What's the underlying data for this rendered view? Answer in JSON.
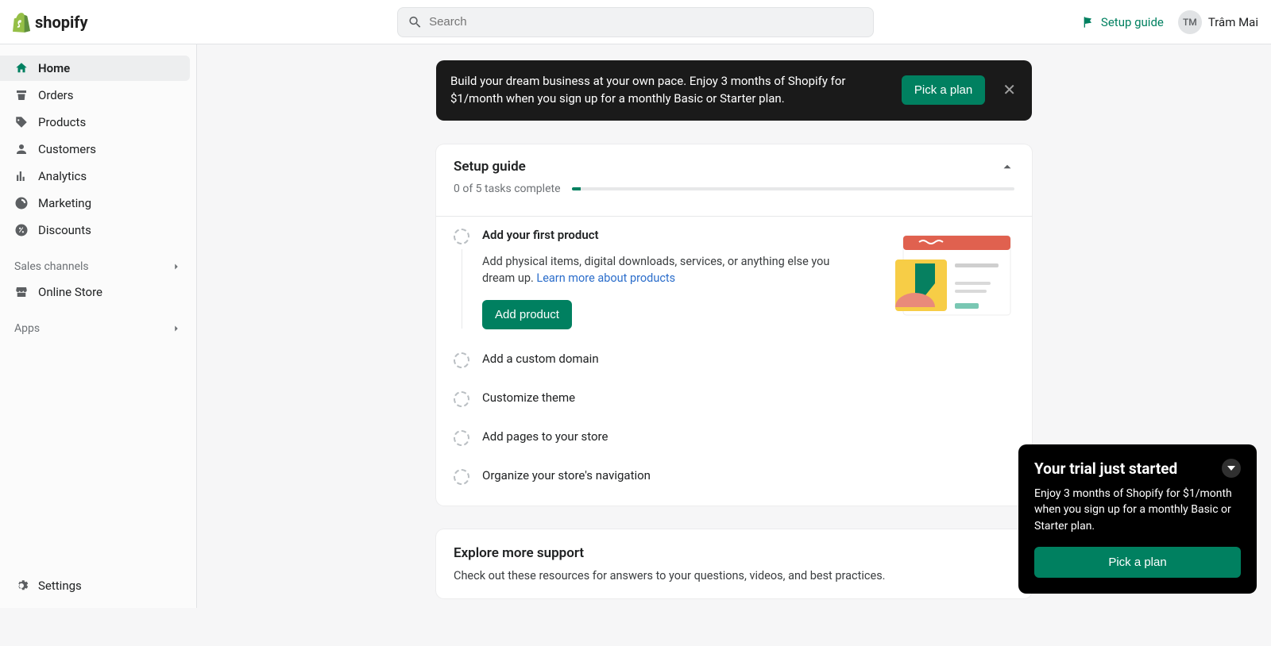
{
  "brand": "shopify",
  "search": {
    "placeholder": "Search"
  },
  "topbar": {
    "setup_link": "Setup guide",
    "user_initials": "TM",
    "user_name": "Trâm Mai"
  },
  "sidebar": {
    "items": [
      {
        "label": "Home"
      },
      {
        "label": "Orders"
      },
      {
        "label": "Products"
      },
      {
        "label": "Customers"
      },
      {
        "label": "Analytics"
      },
      {
        "label": "Marketing"
      },
      {
        "label": "Discounts"
      }
    ],
    "sales_channels_label": "Sales channels",
    "online_store_label": "Online Store",
    "apps_label": "Apps",
    "settings_label": "Settings"
  },
  "banner": {
    "text": "Build your dream business at your own pace. Enjoy 3 months of Shopify for $1/month when you sign up for a monthly Basic or Starter plan.",
    "cta": "Pick a plan"
  },
  "guide": {
    "title": "Setup guide",
    "progress_text": "0 of 5 tasks complete",
    "tasks": {
      "first": {
        "title": "Add your first product",
        "desc_a": "Add physical items, digital downloads, services, or anything else you dream up. ",
        "link": "Learn more about products",
        "cta": "Add product"
      },
      "list": [
        {
          "title": "Add a custom domain"
        },
        {
          "title": "Customize theme"
        },
        {
          "title": "Add pages to your store"
        },
        {
          "title": "Organize your store's navigation"
        }
      ]
    }
  },
  "support": {
    "title": "Explore more support",
    "sub": "Check out these resources for answers to your questions, videos, and best practices."
  },
  "trial": {
    "title": "Your trial just started",
    "body": "Enjoy 3 months of Shopify for $1/month when you sign up for a monthly Basic or Starter plan.",
    "cta": "Pick a plan"
  }
}
